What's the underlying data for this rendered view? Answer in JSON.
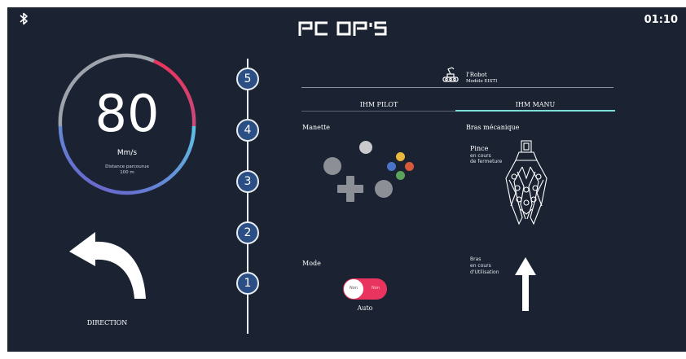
{
  "header": {
    "title": "PC OP'S",
    "time": "01:10"
  },
  "speed": {
    "value": "80",
    "unit": "Mm/s",
    "distance_label": "Distance parcourue",
    "distance_value": "100 m"
  },
  "direction": {
    "label": "DIRECTION"
  },
  "gears": [
    "5",
    "4",
    "3",
    "2",
    "1"
  ],
  "robot": {
    "name": "I'Robot",
    "model": "Modèle EISTI"
  },
  "tabs": {
    "pilot": "IHM PILOT",
    "manu": "IHM MANU",
    "active": "IHM MANU"
  },
  "manette": {
    "label": "Manette"
  },
  "bras_mecanique": {
    "label": "Bras mécanique",
    "pince_title": "Pince",
    "pince_status_1": "en cours",
    "pince_status_2": "de fermeture",
    "bras_title": "Bras",
    "bras_status_1": "en cours",
    "bras_status_2": "d'Utilisation"
  },
  "mode": {
    "label": "Mode",
    "on_text": "Non",
    "off_text": "Non",
    "value": "Auto"
  },
  "colors": {
    "background": "#1b2333",
    "node": "#2b4f84",
    "toggle": "#e8345e",
    "tab_active": "#7de0d8",
    "btn_yellow": "#e8b93c",
    "btn_blue": "#4a74c9",
    "btn_green": "#5aa35a",
    "btn_red": "#d75a3c"
  },
  "icons": [
    "bluetooth-icon",
    "robot-icon",
    "turn-left-arrow-icon",
    "up-arrow-icon",
    "claw-icon",
    "gamepad-icon"
  ]
}
